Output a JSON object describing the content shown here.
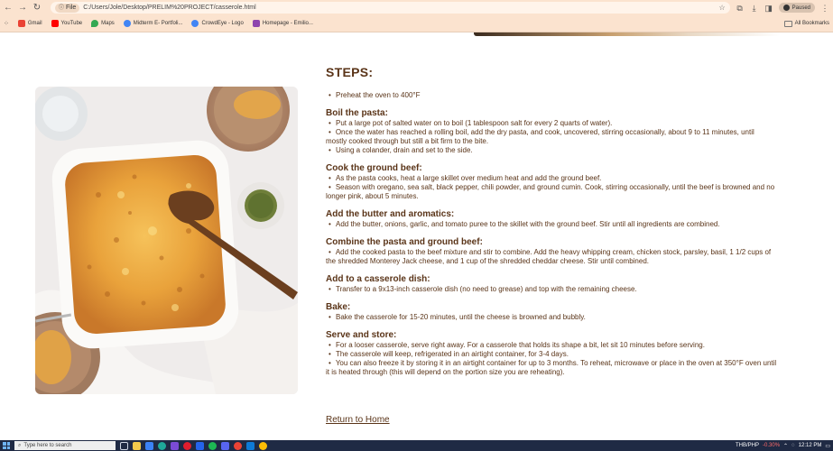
{
  "browser": {
    "file_chip": "File",
    "url": "C:/Users/Jole/Desktop/PRELIM%20PROJECT/casserole.html",
    "profile_label": "Paused",
    "bookmarks": [
      {
        "label": "Gmail",
        "color": "#ea4335"
      },
      {
        "label": "YouTube",
        "color": "#ff0000"
      },
      {
        "label": "Maps",
        "color": "#34a853"
      },
      {
        "label": "Midterm E- Portfoli...",
        "color": "#4285f4"
      },
      {
        "label": "CrowdEye - Logo",
        "color": "#4285f4"
      },
      {
        "label": "Homepage - Emilio...",
        "color": "#8e44ad"
      }
    ],
    "all_bookmarks": "All Bookmarks"
  },
  "steps": {
    "title": "STEPS:",
    "intro": [
      "Preheat the oven to 400°F"
    ],
    "sections": [
      {
        "heading": "Boil the pasta:",
        "items": [
          "Put a large pot of salted water on to boil (1 tablespoon salt for every 2 quarts of water).",
          "Once the water has reached a rolling boil, add the dry pasta, and cook, uncovered, stirring occasionally, about 9 to 11 minutes, until mostly cooked through but still a bit firm to the bite.",
          "Using a colander, drain and set to the side."
        ]
      },
      {
        "heading": "Cook the ground beef:",
        "items": [
          "As the pasta cooks, heat a large skillet over medium heat and add the ground beef.",
          "Season with oregano, sea salt, black pepper, chili powder, and ground cumin. Cook, stirring occasionally, until the beef is browned and no longer pink, about 5 minutes."
        ]
      },
      {
        "heading": "Add the butter and aromatics:",
        "items": [
          "Add the butter, onions, garlic, and tomato puree to the skillet with the ground beef. Stir until all ingredients are combined."
        ]
      },
      {
        "heading": "Combine the pasta and ground beef:",
        "items": [
          "Add the cooked pasta to the beef mixture and stir to combine. Add the heavy whipping cream, chicken stock, parsley, basil, 1 1/2 cups of the shredded Monterey Jack cheese, and 1 cup of the shredded cheddar cheese. Stir until combined."
        ]
      },
      {
        "heading": "Add to a casserole dish:",
        "items": [
          "Transfer to a 9x13-inch casserole dish (no need to grease) and top with the remaining cheese."
        ]
      },
      {
        "heading": "Bake:",
        "items": [
          "Bake the casserole for 15-20 minutes, until the cheese is browned and bubbly."
        ]
      },
      {
        "heading": "Serve and store:",
        "items": [
          "For a looser casserole, serve right away. For a casserole that holds its shape a bit, let sit 10 minutes before serving.",
          "The casserole will keep, refrigerated in an airtight container, for 3-4 days.",
          "You can also freeze it by storing it in an airtight container for up to 3 months. To reheat, microwave or place in the oven at 350°F oven until it is heated through (this will depend on the portion size you are reheating)."
        ]
      }
    ]
  },
  "return_link": "Return to Home",
  "taskbar": {
    "search_placeholder": "Type here to search",
    "ticker": "THB/PHP",
    "ticker_change": "-0.30%",
    "time": "12:12 PM"
  },
  "colors": {
    "text_brown": "#5a3418",
    "chrome_bg": "#fbe3cf"
  }
}
